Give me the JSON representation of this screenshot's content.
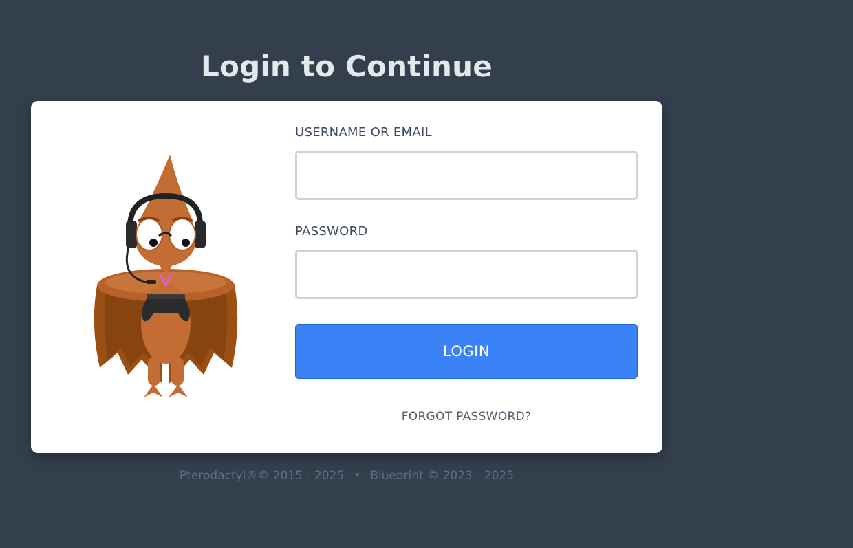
{
  "page": {
    "title": "Login to Continue"
  },
  "form": {
    "username_label": "USERNAME OR EMAIL",
    "username_value": "",
    "password_label": "PASSWORD",
    "password_value": "",
    "login_label": "LOGIN",
    "forgot_label": "FORGOT PASSWORD?"
  },
  "footer": {
    "pterodactyl_text": "Pterodactyl®© 2015 - 2025",
    "separator": "•",
    "blueprint_text": "Blueprint © 2023 - 2025"
  },
  "colors": {
    "background": "#333f4d",
    "card": "#ffffff",
    "accent": "#3b82f6",
    "input_border": "#cbd2d9"
  },
  "icons": {
    "mascot": "pterodactyl-gamer-mascot"
  }
}
